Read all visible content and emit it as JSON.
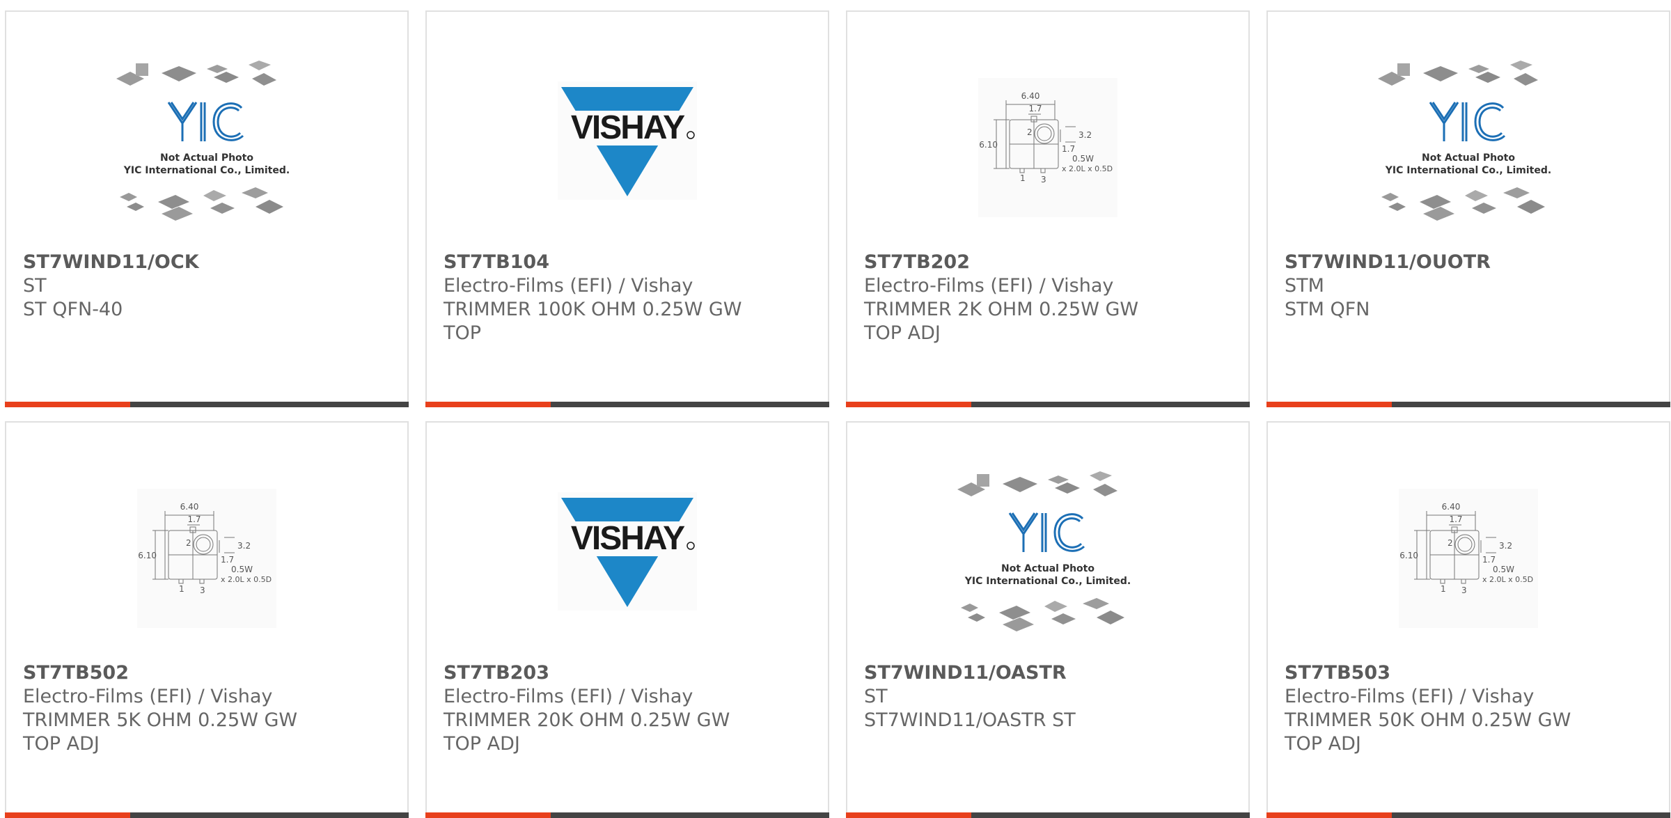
{
  "accent_color": "#e8401c",
  "bar_color": "#444444",
  "progress_fraction": 0.31,
  "logos": {
    "vishay_text": "VISHAY",
    "yic_line1": "Not Actual Photo",
    "yic_line2": "YIC International Co., Limited."
  },
  "drawing": {
    "dim_640": "6.40",
    "dim_17": "1.7",
    "dim_610": "6.10",
    "dim_32": "3.2",
    "dim_17b": "1.7",
    "dim_05w": "0.5W",
    "dim_size": "x 2.0L x 0.5D",
    "pin_2": "2",
    "pin_1": "1",
    "pin_3": "3"
  },
  "products": [
    {
      "part": "ST7WIND11/OCK",
      "maker": "ST",
      "desc": "ST QFN-40",
      "desc2": "",
      "image": "yic-icon"
    },
    {
      "part": "ST7TB104",
      "maker": "Electro-Films (EFI) / Vishay",
      "desc": "TRIMMER 100K OHM 0.25W GW",
      "desc2": "TOP",
      "image": "vishay-icon"
    },
    {
      "part": "ST7TB202",
      "maker": "Electro-Films (EFI) / Vishay",
      "desc": "TRIMMER 2K OHM 0.25W GW",
      "desc2": "TOP ADJ",
      "image": "trimmer-drawing-icon"
    },
    {
      "part": "ST7WIND11/OUOTR",
      "maker": "STM",
      "desc": "STM QFN",
      "desc2": "",
      "image": "yic-icon"
    },
    {
      "part": "ST7TB502",
      "maker": "Electro-Films (EFI) / Vishay",
      "desc": "TRIMMER 5K OHM 0.25W GW",
      "desc2": "TOP ADJ",
      "image": "trimmer-drawing-icon"
    },
    {
      "part": "ST7TB203",
      "maker": "Electro-Films (EFI) / Vishay",
      "desc": "TRIMMER 20K OHM 0.25W GW",
      "desc2": "TOP ADJ",
      "image": "vishay-icon"
    },
    {
      "part": "ST7WIND11/OASTR",
      "maker": "ST",
      "desc": "ST7WIND11/OASTR ST",
      "desc2": "",
      "image": "yic-icon"
    },
    {
      "part": "ST7TB503",
      "maker": "Electro-Films (EFI) / Vishay",
      "desc": "TRIMMER 50K OHM 0.25W GW",
      "desc2": "TOP ADJ",
      "image": "trimmer-drawing-icon"
    }
  ]
}
